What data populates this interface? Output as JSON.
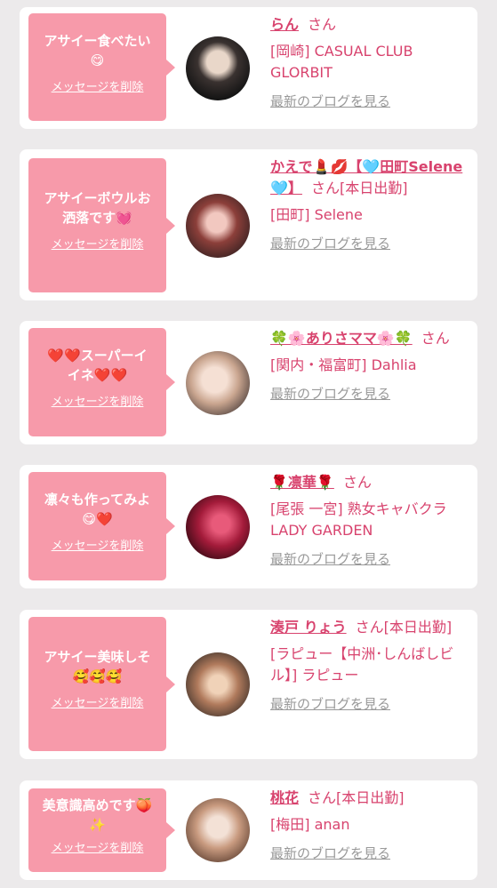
{
  "delete_label": "メッセージを削除",
  "blog_label": "最新のブログを見る",
  "san_label": "さん",
  "items": [
    {
      "message": "アサイー食べたい\n😋",
      "name": "らん",
      "status": "",
      "shop": "[岡崎] CASUAL CLUB GLORBIT"
    },
    {
      "message": "アサイーボウルお\n洒落です💓",
      "name": "かえで💄💋【🩵田町Selene🩵】",
      "status": "[本日出勤]",
      "shop": "[田町] Selene"
    },
    {
      "message": "❤️❤️スーパーイ\nイネ❤️❤️",
      "name": "🍀🌸ありさママ🌸🍀",
      "status": "",
      "shop": "[関内・福富町] Dahlia"
    },
    {
      "message": "凛々も作ってみよ\n😋❤️",
      "name": "🌹凛華🌹",
      "status": "",
      "shop": "[尾張 一宮] 熟女キャバクラ LADY GARDEN"
    },
    {
      "message": "アサイー美味しそ\n🥰🥰🥰",
      "name": "湊戸 りょう",
      "status": "[本日出勤]",
      "shop": "[ラピュー【中洲･しんばしビル】] ラピュー"
    },
    {
      "message": "美意識高めです🍑\n✨",
      "name": "桃花",
      "status": "[本日出勤]",
      "shop": "[梅田] anan"
    }
  ],
  "colors": {
    "background": "#eceaeb",
    "bubble": "#f79aaa",
    "accent": "#d8436e",
    "link_gray": "#999999"
  }
}
